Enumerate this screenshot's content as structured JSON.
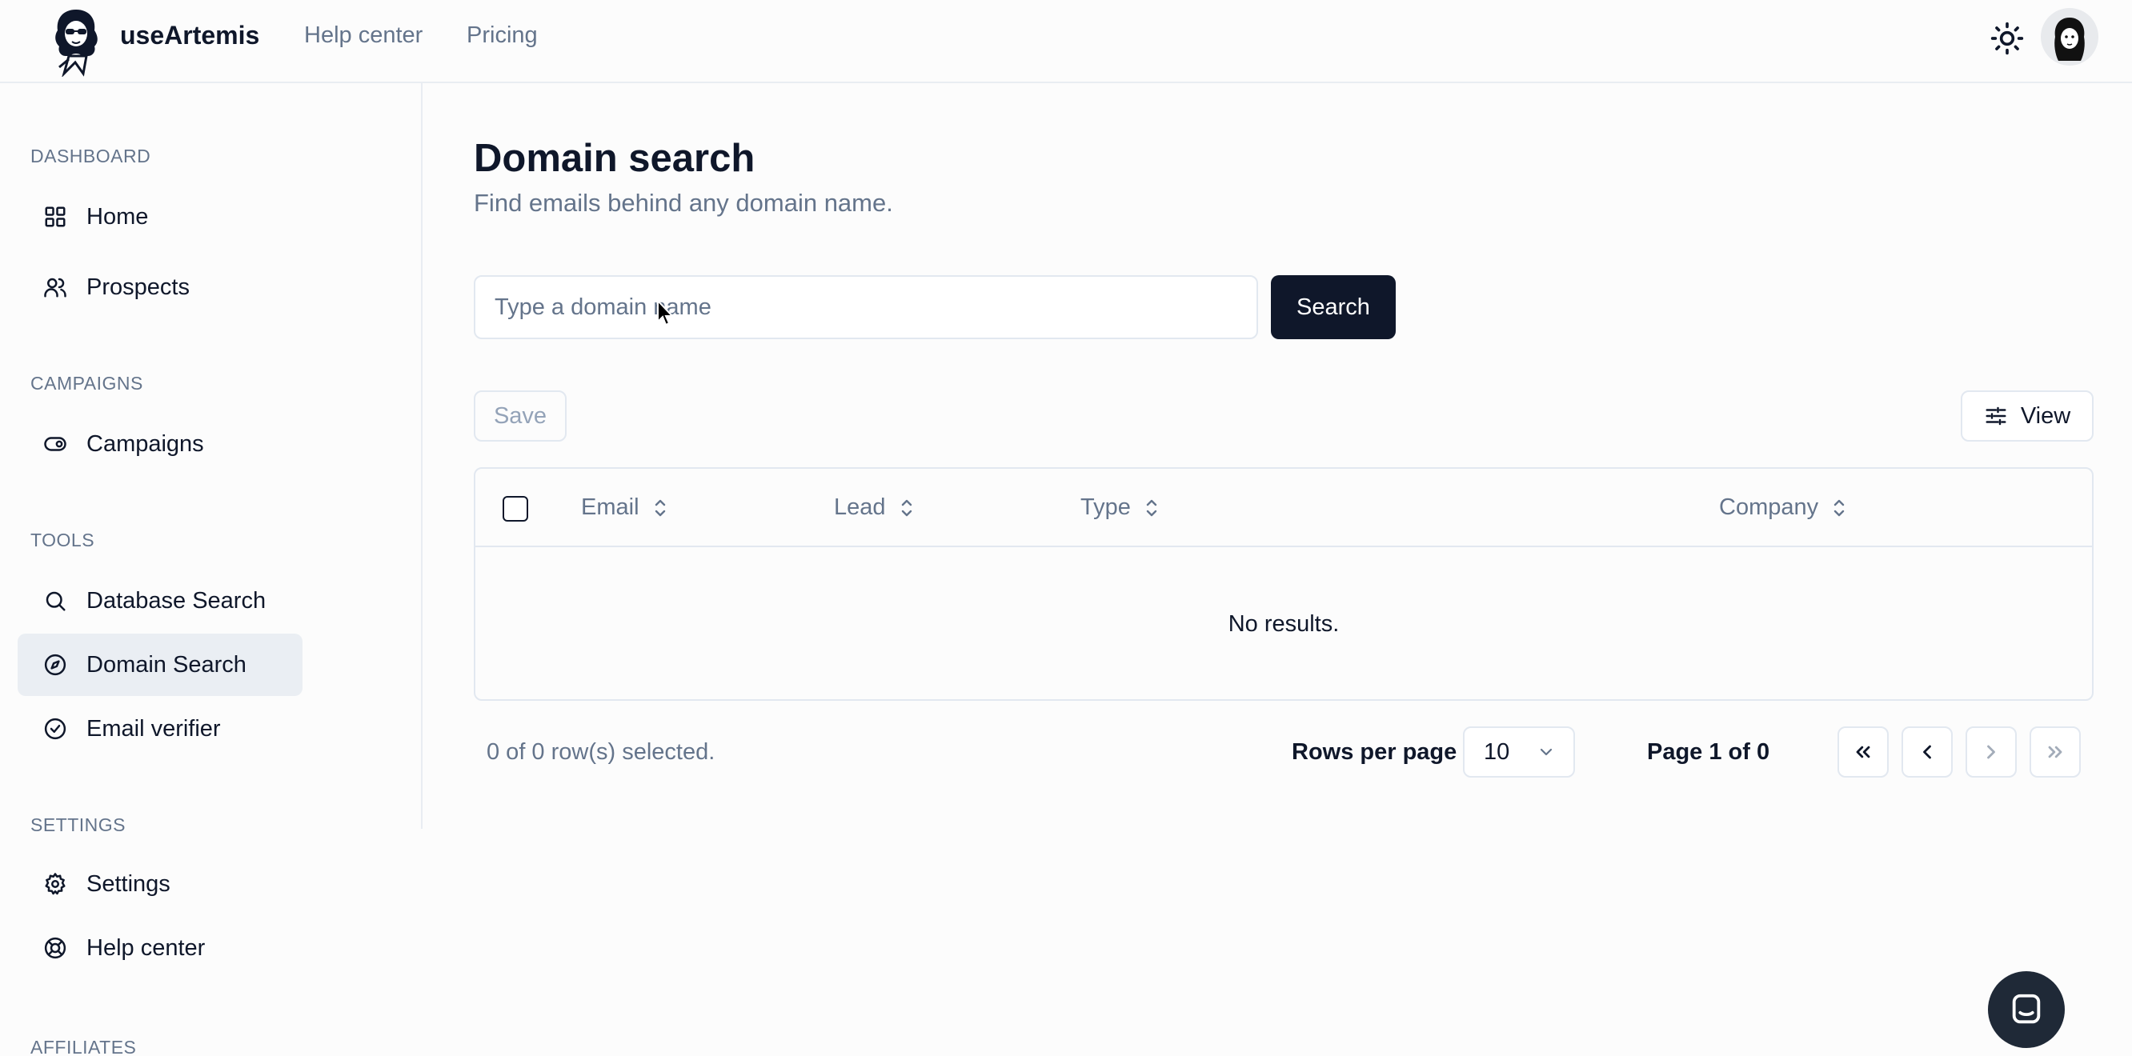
{
  "app": {
    "brand": "useArtemis",
    "nav": [
      {
        "label": "Help center"
      },
      {
        "label": "Pricing"
      }
    ]
  },
  "sidebar": {
    "sections": [
      {
        "title": "DASHBOARD",
        "items": [
          {
            "label": "Home",
            "icon": "grid-icon"
          },
          {
            "label": "Prospects",
            "icon": "users-icon"
          }
        ]
      },
      {
        "title": "CAMPAIGNS",
        "items": [
          {
            "label": "Campaigns",
            "icon": "toggle-icon"
          }
        ]
      },
      {
        "title": "TOOLS",
        "items": [
          {
            "label": "Database Search",
            "icon": "search-icon"
          },
          {
            "label": "Domain Search",
            "icon": "compass-icon",
            "active": true
          },
          {
            "label": "Email verifier",
            "icon": "check-circle-icon"
          }
        ]
      },
      {
        "title": "SETTINGS",
        "items": [
          {
            "label": "Settings",
            "icon": "gear-icon"
          },
          {
            "label": "Help center",
            "icon": "lifebuoy-icon"
          }
        ]
      },
      {
        "title": "AFFILIATES",
        "items": []
      }
    ]
  },
  "main": {
    "title": "Domain search",
    "subtitle": "Find emails behind any domain name.",
    "search": {
      "placeholder": "Type a domain name",
      "value": "",
      "button": "Search"
    },
    "toolbar": {
      "save_label": "Save",
      "view_label": "View"
    },
    "table": {
      "columns": [
        "Email",
        "Lead",
        "Type",
        "Company"
      ],
      "rows": [],
      "empty_text": "No results."
    },
    "footer": {
      "selected": "0 of 0 row(s) selected.",
      "rows_per_page_label": "Rows per page",
      "rows_per_page_value": "10",
      "page_info": "Page 1 of 0"
    }
  },
  "colors": {
    "primary": "#0f172a",
    "muted": "#64748b",
    "border": "#e2e8f0",
    "active_bg": "#eaeef3"
  }
}
